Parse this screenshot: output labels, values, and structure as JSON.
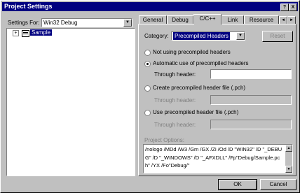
{
  "window": {
    "title": "Project Settings",
    "help_btn": "?",
    "close_btn": "X"
  },
  "left": {
    "settings_for_label": "Settings For:",
    "settings_for_value": "Win32 Debug",
    "tree_expand": "+",
    "tree_item": "Sample"
  },
  "tabs": [
    {
      "label": "General"
    },
    {
      "label": "Debug"
    },
    {
      "label": "C/C++"
    },
    {
      "label": "Link"
    },
    {
      "label": "Resource"
    }
  ],
  "tab_scroll": {
    "left": "◄",
    "right": "►"
  },
  "cpp": {
    "category_label": "Category:",
    "category_value": "Precompiled Headers",
    "reset_button": "Reset",
    "options": [
      {
        "label": "Not using precompiled headers",
        "selected": false
      },
      {
        "label": "Automatic use of precompiled headers",
        "selected": true
      },
      {
        "label": "Create precompiled header file (.pch)",
        "selected": false
      },
      {
        "label": "Use precompiled header file (.pch)",
        "selected": false
      }
    ],
    "through_header_label": "Through header:",
    "through_header_label_2": "Through header:",
    "through_header_label_3": "Through header:",
    "project_options_label": "Project Options:",
    "project_options_text": "/nologo /MDd /W3 /Gm /GX /Zi /Od /D \"WIN32\" /D \"_DEBUG\" /D \"_WINDOWS\" /D \"_AFXDLL\" /Fp\"Debug/Sample.pch\" /YX /Fo\"Debug/\""
  },
  "buttons": {
    "ok": "OK",
    "cancel": "Cancel"
  }
}
